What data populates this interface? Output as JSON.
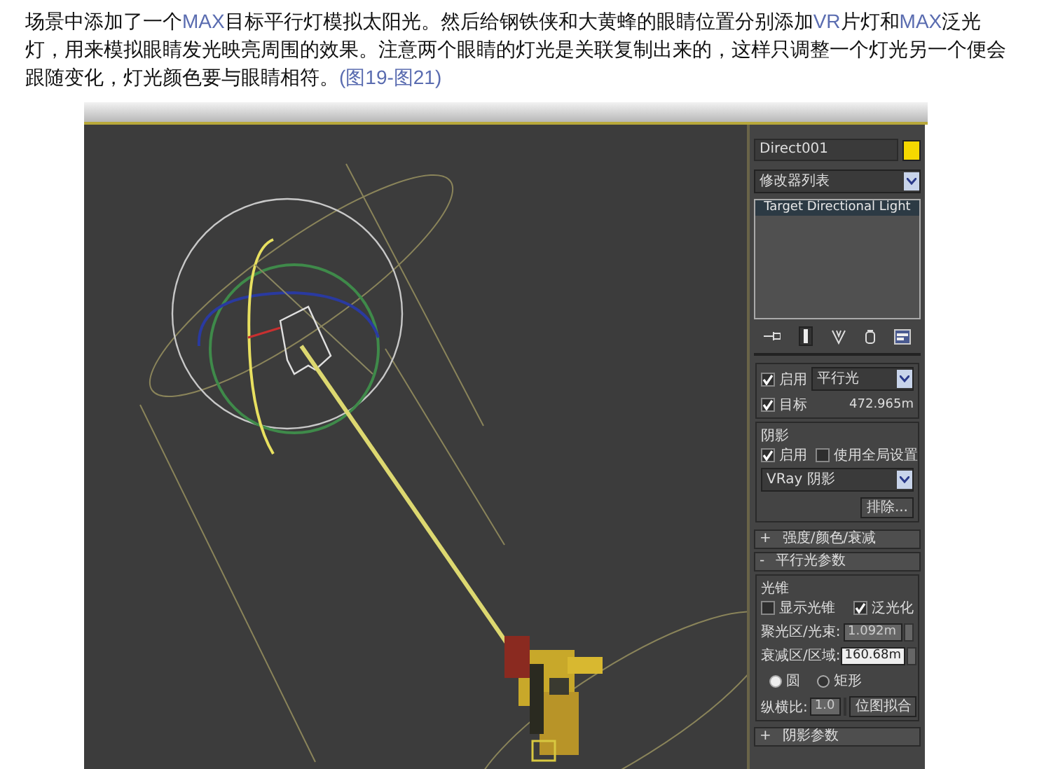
{
  "article": {
    "segments": [
      {
        "text": "场景中添加了一个",
        "highlighted": false
      },
      {
        "text": "MAX",
        "highlighted": true
      },
      {
        "text": "目标平行灯模拟太阳光。然后给钢铁侠和大黄蜂的眼睛位置分别添加",
        "highlighted": false
      },
      {
        "text": "VR",
        "highlighted": true
      },
      {
        "text": "片灯和",
        "highlighted": false
      },
      {
        "text": "MAX",
        "highlighted": true
      },
      {
        "text": "泛光灯，用来模拟眼睛发光映亮周围的效果。注意两个眼睛的灯光是关联复制出来的，这样只调整一个灯光另一个便会跟随变化，灯光颜色要与眼睛相符。",
        "highlighted": false
      },
      {
        "text": "(图19-图21)",
        "highlighted": true
      }
    ]
  },
  "command_panel": {
    "object": {
      "name": "Direct001",
      "color": "#f5d800"
    },
    "modifier_list": {
      "value": "修改器列表"
    },
    "modifier_stack": [
      {
        "label": "Target Directional Light",
        "selected": true
      }
    ],
    "general_parameters": {
      "light_on": {
        "label": "启用",
        "checked": true
      },
      "light_type": {
        "value": "平行光"
      },
      "targeted": {
        "label": "目标",
        "checked": true
      },
      "target_distance": "472.965m",
      "shadows": {
        "title": "阴影",
        "on": {
          "label": "启用",
          "checked": true
        },
        "use_global": {
          "label": "使用全局设置",
          "checked": false
        },
        "shadow_type": {
          "value": "VRay 阴影"
        },
        "exclude_button": "排除..."
      }
    },
    "rollouts": [
      {
        "sign": "+",
        "title": "强度/颜色/衰减"
      },
      {
        "sign": "-",
        "title": "平行光参数"
      }
    ],
    "directional_parameters": {
      "group_title": "光锥",
      "show_cone": {
        "label": "显示光锥",
        "checked": false
      },
      "overshoot": {
        "label": "泛光化",
        "checked": true
      },
      "hotspot": {
        "label": "聚光区/光束:",
        "value": "1.092m",
        "disabled": true
      },
      "falloff": {
        "label": "衰减区/区域:",
        "value": "160.68m",
        "disabled": false
      },
      "shape": [
        {
          "label": "圆",
          "selected": true
        },
        {
          "label": "矩形",
          "selected": false
        }
      ],
      "aspect": {
        "label": "纵横比:",
        "value": "1.0",
        "disabled": true
      },
      "bitmap_fit_button": "位图拟合"
    },
    "bottom_rollout": {
      "sign": "+",
      "title": "阴影参数"
    }
  }
}
